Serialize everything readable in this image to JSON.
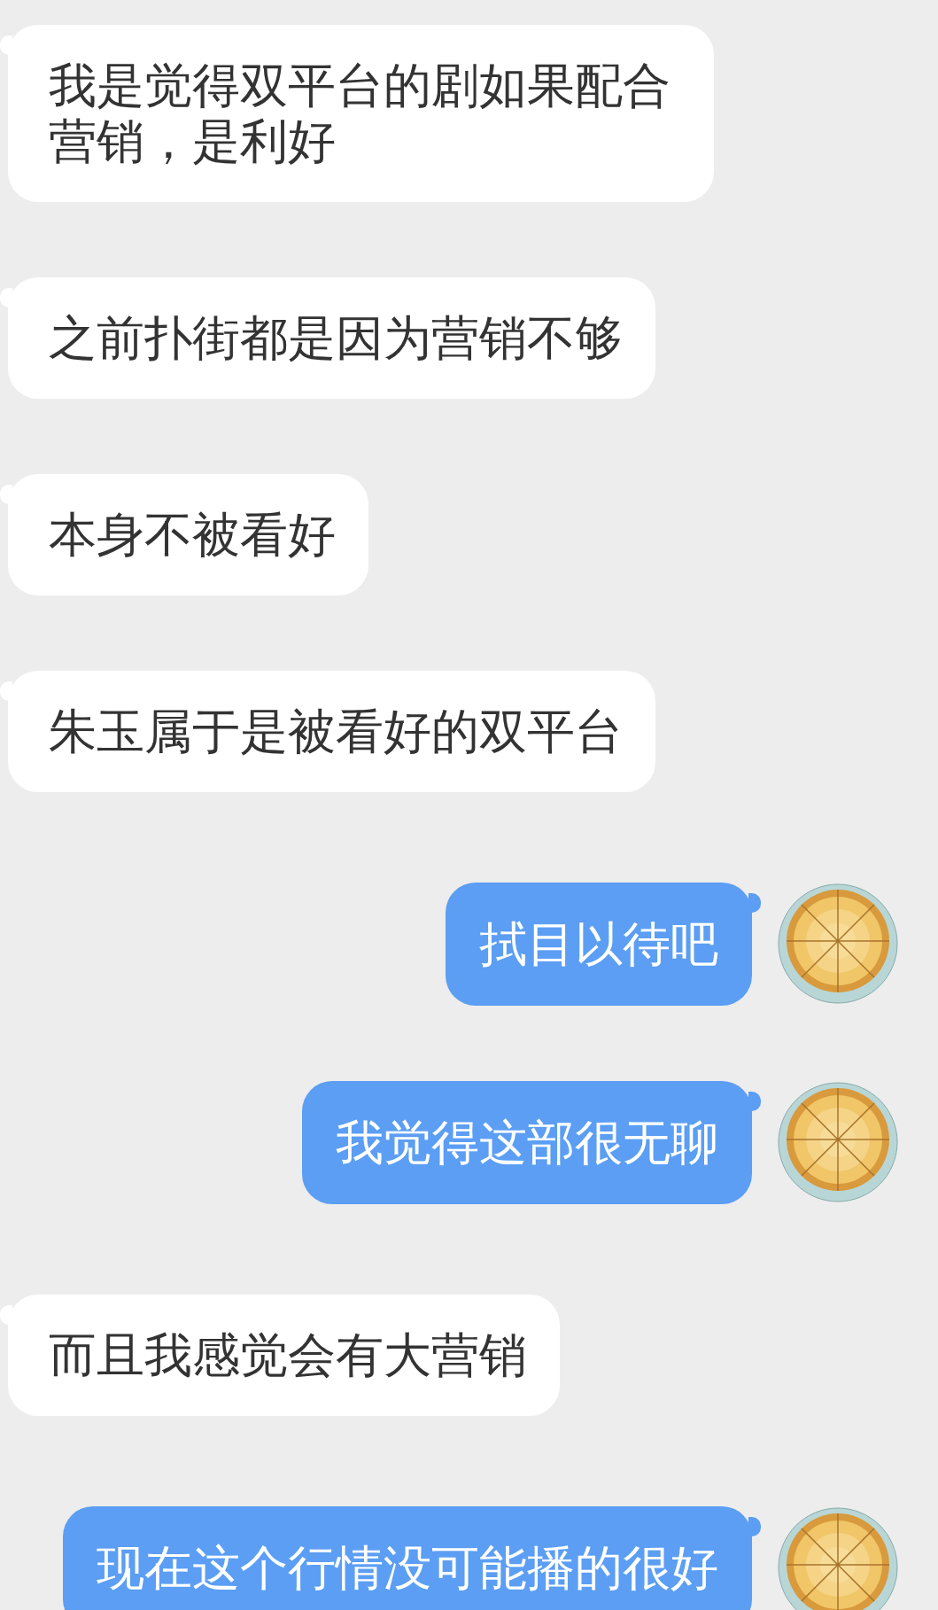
{
  "messages": [
    {
      "kind": "incoming",
      "text": "我是觉得双平台的剧如果配合营销，是利好"
    },
    {
      "kind": "incoming",
      "text": "之前扑街都是因为营销不够"
    },
    {
      "kind": "incoming",
      "text": "本身不被看好"
    },
    {
      "kind": "incoming",
      "text": "朱玉属于是被看好的双平台"
    },
    {
      "kind": "outgoing",
      "text": "拭目以待吧"
    },
    {
      "kind": "outgoing",
      "text": "我觉得这部很无聊"
    },
    {
      "kind": "incoming",
      "text": "而且我感觉会有大营销"
    },
    {
      "kind": "outgoing",
      "text": "现在这个行情没可能播的很好"
    }
  ]
}
